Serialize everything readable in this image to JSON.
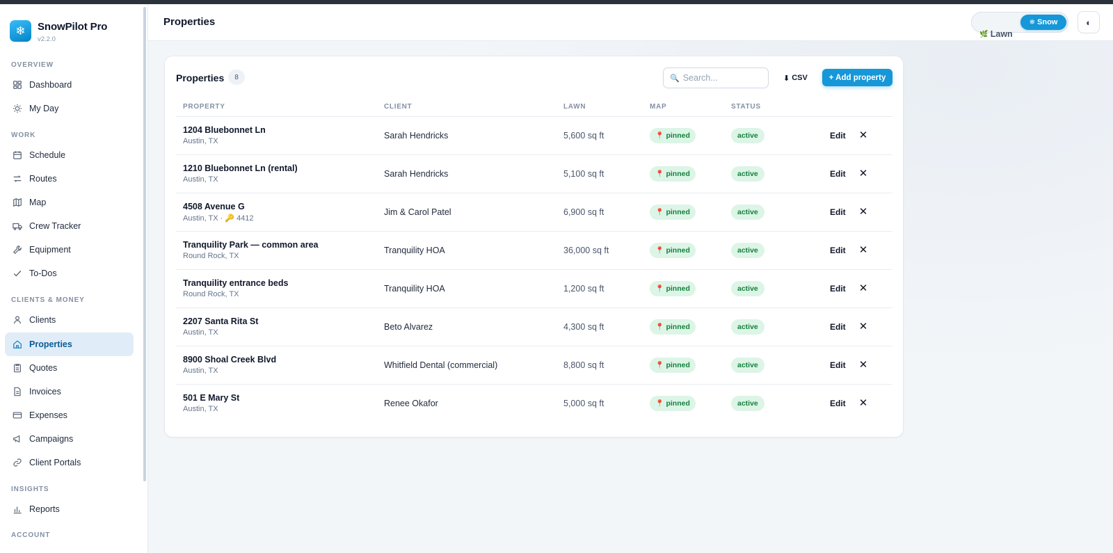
{
  "app": {
    "name": "SnowPilot Pro",
    "version": "v2.2.0"
  },
  "sidebar": {
    "sections": [
      {
        "label": "OVERVIEW"
      },
      {
        "label": "WORK"
      },
      {
        "label": "CLIENTS & MONEY"
      },
      {
        "label": "INSIGHTS"
      },
      {
        "label": "ACCOUNT"
      }
    ],
    "items": [
      {
        "label": "Dashboard",
        "icon": "dashboard-icon"
      },
      {
        "label": "My Day",
        "icon": "sun-icon"
      },
      {
        "label": "Schedule",
        "icon": "calendar-icon"
      },
      {
        "label": "Routes",
        "icon": "routes-icon"
      },
      {
        "label": "Map",
        "icon": "map-icon"
      },
      {
        "label": "Crew Tracker",
        "icon": "truck-icon"
      },
      {
        "label": "Equipment",
        "icon": "wrench-icon"
      },
      {
        "label": "To-Dos",
        "icon": "check-icon"
      },
      {
        "label": "Clients",
        "icon": "user-icon"
      },
      {
        "label": "Properties",
        "icon": "home-icon",
        "active": true
      },
      {
        "label": "Quotes",
        "icon": "clipboard-icon"
      },
      {
        "label": "Invoices",
        "icon": "document-icon"
      },
      {
        "label": "Expenses",
        "icon": "credit-card-icon"
      },
      {
        "label": "Campaigns",
        "icon": "megaphone-icon"
      },
      {
        "label": "Client Portals",
        "icon": "link-icon"
      },
      {
        "label": "Reports",
        "icon": "bar-chart-icon"
      }
    ]
  },
  "header": {
    "title": "Properties",
    "mode_toggle": {
      "lawn_label": "Lawn",
      "snow_label": "Snow",
      "selected": "Snow"
    },
    "theme_toggle_icon": "half-circle-icon"
  },
  "card": {
    "title": "Properties",
    "count": "8",
    "search_placeholder": "Search...",
    "csv_label": "CSV",
    "add_label": "+ Add property"
  },
  "table": {
    "columns": [
      "PROPERTY",
      "CLIENT",
      "LAWN",
      "MAP",
      "STATUS"
    ],
    "edit_label": "Edit",
    "rows": [
      {
        "name": "1204 Bluebonnet Ln",
        "city": "Austin, TX",
        "client": "Sarah Hendricks",
        "lawn": "5,600 sq ft",
        "map": "pinned",
        "status": "active"
      },
      {
        "name": "1210 Bluebonnet Ln (rental)",
        "city": "Austin, TX",
        "client": "Sarah Hendricks",
        "lawn": "5,100 sq ft",
        "map": "pinned",
        "status": "active"
      },
      {
        "name": "4508 Avenue G",
        "city": "Austin, TX · 🔑 4412",
        "client": "Jim & Carol Patel",
        "lawn": "6,900 sq ft",
        "map": "pinned",
        "status": "active"
      },
      {
        "name": "Tranquility Park — common area",
        "city": "Round Rock, TX",
        "client": "Tranquility HOA",
        "lawn": "36,000 sq ft",
        "map": "pinned",
        "status": "active"
      },
      {
        "name": "Tranquility entrance beds",
        "city": "Round Rock, TX",
        "client": "Tranquility HOA",
        "lawn": "1,200 sq ft",
        "map": "pinned",
        "status": "active"
      },
      {
        "name": "2207 Santa Rita St",
        "city": "Austin, TX",
        "client": "Beto Alvarez",
        "lawn": "4,300 sq ft",
        "map": "pinned",
        "status": "active"
      },
      {
        "name": "8900 Shoal Creek Blvd",
        "city": "Austin, TX",
        "client": "Whitfield Dental (commercial)",
        "lawn": "8,800 sq ft",
        "map": "pinned",
        "status": "active"
      },
      {
        "name": "501 E Mary St",
        "city": "Austin, TX",
        "client": "Renee Okafor",
        "lawn": "5,000 sq ft",
        "map": "pinned",
        "status": "active"
      }
    ]
  },
  "colors": {
    "accent": "#1597d8",
    "active_nav_bg": "#e0edf8",
    "pill_bg": "#dcf5e6",
    "pill_text": "#15803d"
  }
}
